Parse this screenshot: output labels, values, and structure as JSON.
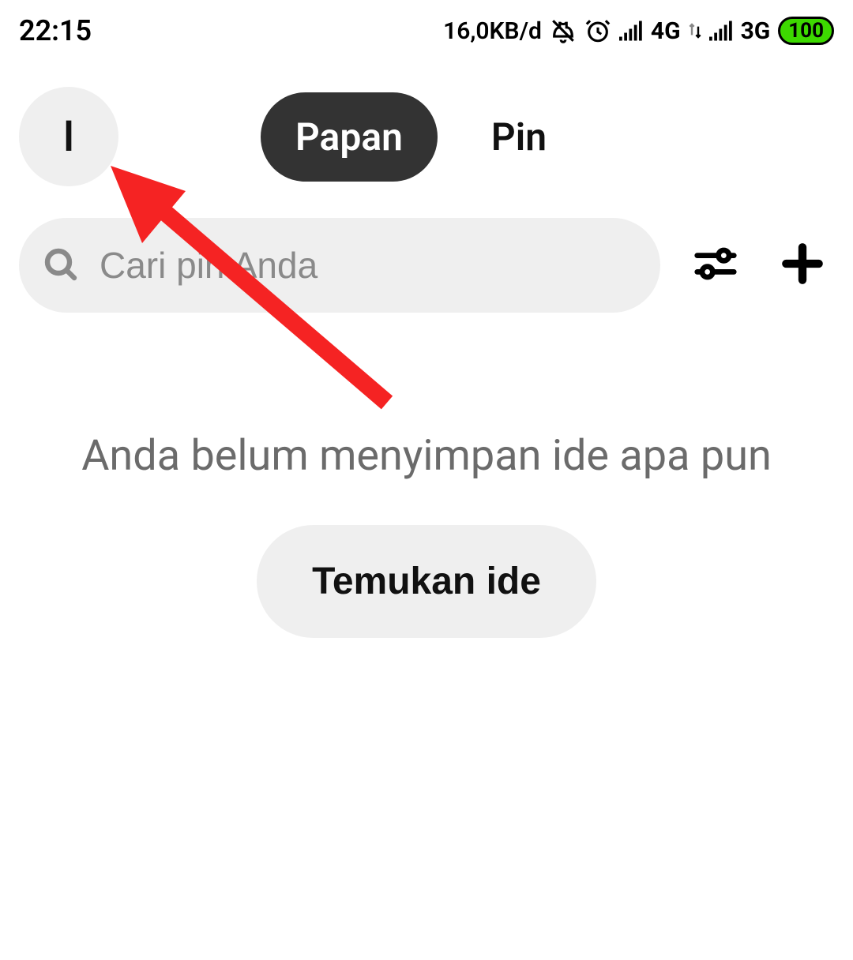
{
  "status_bar": {
    "time": "22:15",
    "data_rate": "16,0KB/d",
    "net1": "4G",
    "net2": "3G",
    "battery": "100"
  },
  "header": {
    "avatar_initial": "I",
    "tabs": [
      {
        "label": "Papan",
        "active": true
      },
      {
        "label": "Pin",
        "active": false
      }
    ]
  },
  "search": {
    "placeholder": "Cari pin Anda"
  },
  "empty_state": {
    "message": "Anda belum menyimpan ide apa pun",
    "button_label": "Temukan ide"
  },
  "annotation": {
    "type": "arrow",
    "color": "#f52323",
    "target": "avatar"
  }
}
